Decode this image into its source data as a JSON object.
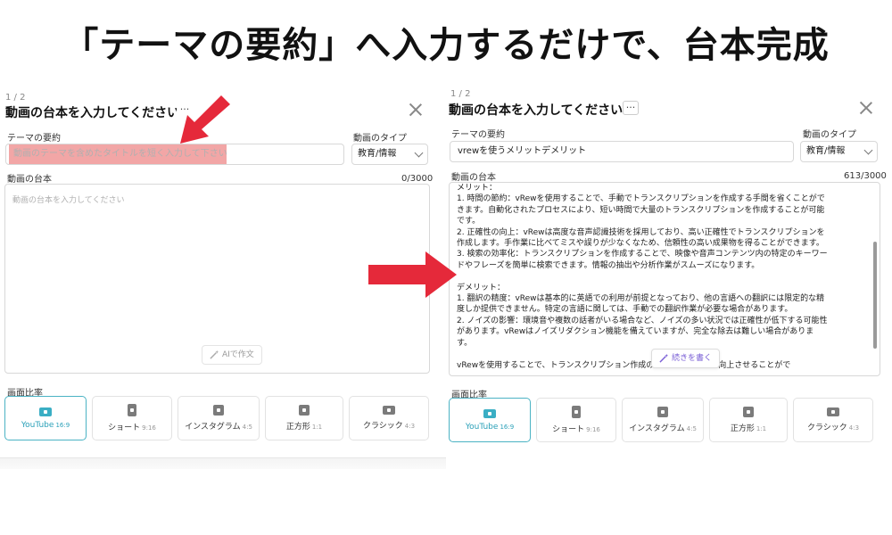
{
  "headline": "「テーマの要約」へ入力するだけで、台本完成",
  "colors": {
    "arrow": "#e5293a",
    "accent": "#3aaec4",
    "highlight": "#f09696",
    "ai_purple": "#7a5fd6"
  },
  "left": {
    "step": "1 / 2",
    "title": "動画の台本を入力してください",
    "more": "···",
    "theme_label": "テーマの要約",
    "theme_placeholder": "動画のテーマを含めたタイトルを短く入力して下さい",
    "type_label": "動画のタイプ",
    "type_value": "教育/情報",
    "script_label": "動画の台本",
    "counter": "0/3000",
    "script_placeholder": "動画の台本を入力してください",
    "ai_button": "AIで作文",
    "ratio_label": "画面比率"
  },
  "right": {
    "step": "1 / 2",
    "title": "動画の台本を入力してください",
    "more": "···",
    "theme_label": "テーマの要約",
    "theme_value": "vrewを使うメリットデメリット",
    "type_label": "動画のタイプ",
    "type_value": "教育/情報",
    "script_label": "動画の台本",
    "counter": "613/3000",
    "script_lines": [
      "メリット：",
      "1. 時間の節約：vRewを使用することで、手動でトランスクリプションを作成する手間を省くことがで",
      "きます。自動化されたプロセスにより、短い時間で大量のトランスクリプションを作成することが可能",
      "です。",
      "2. 正確性の向上：vRewは高度な音声認識技術を採用しており、高い正確性でトランスクリプションを",
      "作成します。手作業に比べてミスや誤りが少なくなため、信頼性の高い成果物を得ることができます。",
      "3. 検索の効率化：トランスクリプションを作成することで、映像や音声コンテンツ内の特定のキーワー",
      "ドやフレーズを簡単に検索できます。情報の抽出や分析作業がスムーズになります。",
      "",
      "デメリット：",
      "1. 翻訳の精度：vRewは基本的に英語での利用が前提となっており、他の言語への翻訳には限定的な精",
      "度しか提供できません。特定の言語に関しては、手動での翻訳作業が必要な場合があります。",
      "2. ノイズの影響：環境音や複数の話者がいる場合など、ノイズの多い状況では正確性が低下する可能性",
      "があります。vRewはノイズリダクション機能を備えていますが、完全な除去は難しい場合がありま",
      "す。",
      "",
      "vRewを使用することで、トランスクリプション作成の効率化と正確性を向上させることがで"
    ],
    "continue_button": "続きを書く",
    "ratio_label": "画面比率"
  },
  "ratios": [
    {
      "name": "YouTube",
      "sub": "16:9",
      "icon": "youtube-icon",
      "selected": true
    },
    {
      "name": "ショート",
      "sub": "9:16",
      "icon": "shorts-icon",
      "selected": false
    },
    {
      "name": "インスタグラム",
      "sub": "4:5",
      "icon": "instagram-icon",
      "selected": false
    },
    {
      "name": "正方形",
      "sub": "1:1",
      "icon": "square-icon",
      "selected": false
    },
    {
      "name": "クラシック",
      "sub": "4:3",
      "icon": "classic-icon",
      "selected": false
    }
  ]
}
